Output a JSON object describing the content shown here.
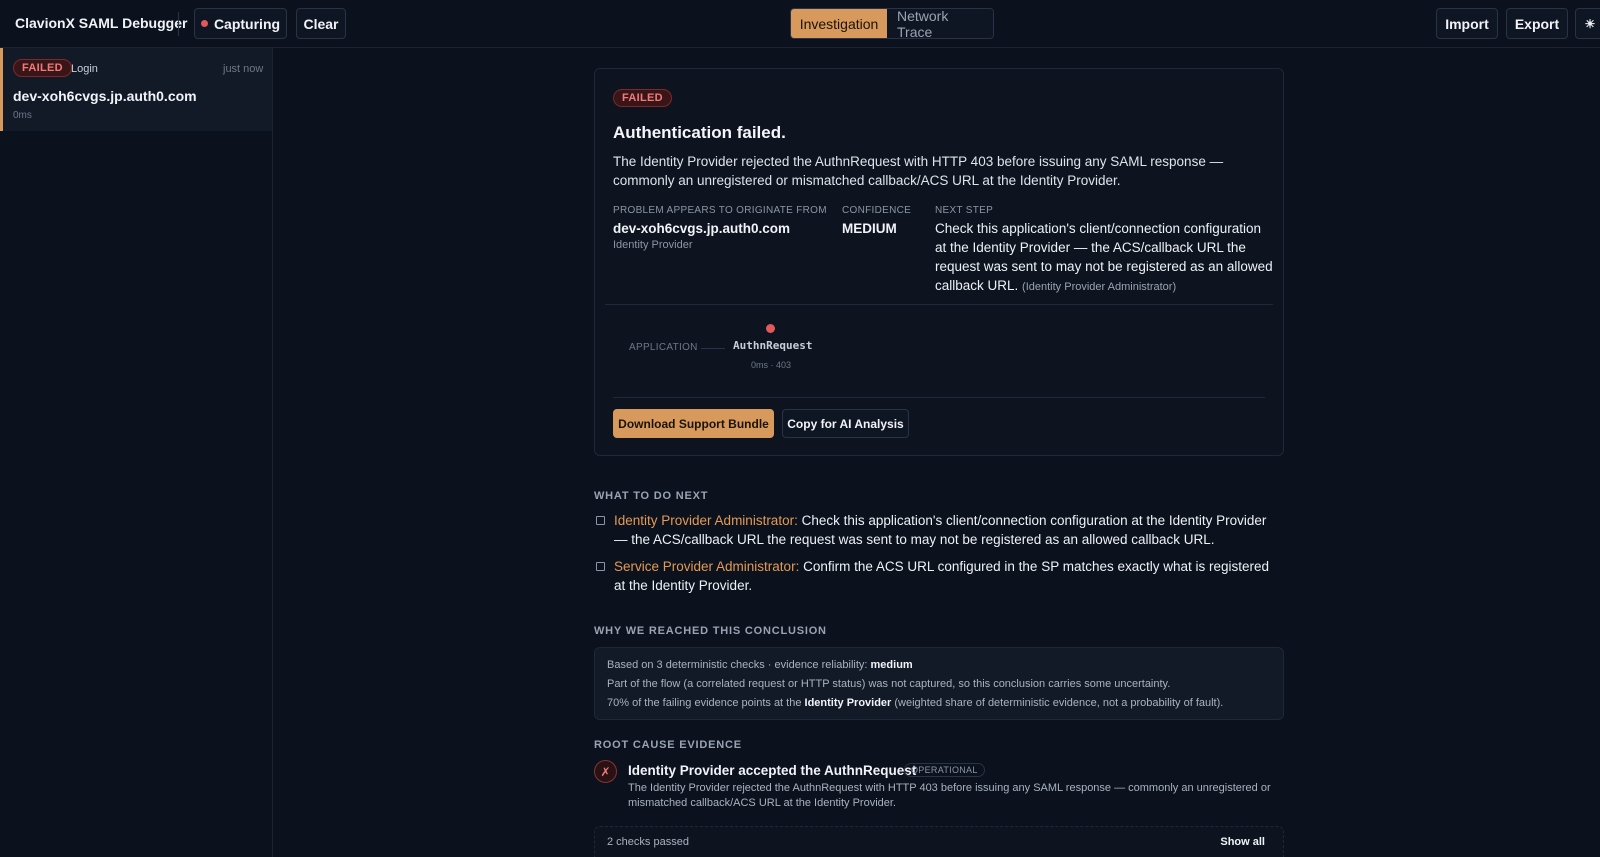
{
  "app": {
    "title": "ClavionX SAML Debugger",
    "capture_label": "Capturing",
    "clear_label": "Clear",
    "tabs": [
      "Investigation",
      "Network Trace"
    ],
    "import_label": "Import",
    "export_label": "Export",
    "theme_glyph": "☀"
  },
  "sidebar": {
    "sessions": [
      {
        "status": "FAILED",
        "label": "Login",
        "time": "just now",
        "host": "dev-xoh6cvgs.jp.auth0.com",
        "duration": "0ms"
      }
    ]
  },
  "summary": {
    "status": "FAILED",
    "title": "Authentication failed.",
    "description": "The Identity Provider rejected the AuthnRequest with HTTP 403 before issuing any SAML response — commonly an unregistered or mismatched callback/ACS URL at the Identity Provider.",
    "origin_label": "PROBLEM APPEARS TO ORIGINATE FROM",
    "origin_value": "dev-xoh6cvgs.jp.auth0.com",
    "origin_sub": "Identity Provider",
    "confidence_label": "CONFIDENCE",
    "confidence_value": "MEDIUM",
    "next_step_label": "NEXT STEP",
    "next_step_text": "Check this application's client/connection configuration at the Identity Provider — the ACS/callback URL the request was sent to may not be registered as an allowed callback URL.",
    "next_step_owner": "(Identity Provider Administrator)"
  },
  "flow": {
    "source": "APPLICATION",
    "step_name": "AuthnRequest",
    "step_detail": "0ms · 403",
    "step_color": "#e05a5a"
  },
  "actions": {
    "download_label": "Download Support Bundle",
    "copy_label": "Copy for AI Analysis"
  },
  "todo": {
    "heading": "WHAT TO DO NEXT",
    "items": [
      {
        "role": "Identity Provider Administrator:",
        "text": " Check this application's client/connection configuration at the Identity Provider — the ACS/callback URL the request was sent to may not be registered as an allowed callback URL."
      },
      {
        "role": "Service Provider Administrator:",
        "text": " Confirm the ACS URL configured in the SP matches exactly what is registered at the Identity Provider."
      }
    ]
  },
  "why": {
    "heading": "WHY WE REACHED THIS CONCLUSION",
    "line1_prefix": "Based on 3 deterministic checks · evidence reliability: ",
    "line1_strong": "medium",
    "line2": "Part of the flow (a correlated request or HTTP status) was not captured, so this conclusion carries some uncertainty.",
    "line3_prefix": "70% of the failing evidence points at the ",
    "line3_strong": "Identity Provider",
    "line3_suffix": " (weighted share of deterministic evidence, not a probability of fault)."
  },
  "evidence": {
    "heading": "ROOT CAUSE EVIDENCE",
    "icon_glyph": "✗",
    "title": "Identity Provider accepted the AuthnRequest",
    "tag": "OPERATIONAL",
    "description": "The Identity Provider rejected the AuthnRequest with HTTP 403 before issuing any SAML response — commonly an unregistered or mismatched callback/ACS URL at the Identity Provider.",
    "passed_label": "2 checks passed",
    "show_all_label": "Show all"
  },
  "colors": {
    "accent": "#d89a5c",
    "failed": "#e05a5a",
    "background": "#0b111d"
  }
}
